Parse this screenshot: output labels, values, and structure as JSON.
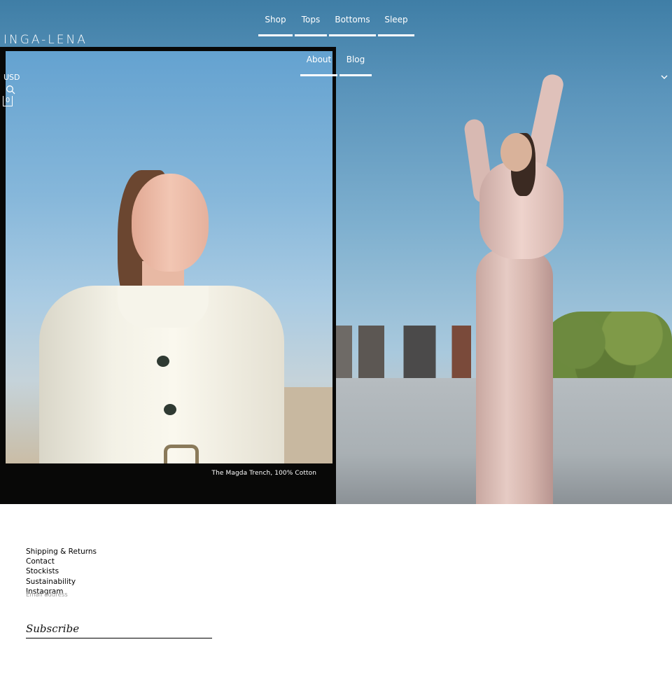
{
  "brand": {
    "logo_text": "INGA-LENA"
  },
  "nav": {
    "row1": [
      {
        "label": "Shop"
      },
      {
        "label": "Tops"
      },
      {
        "label": "Bottoms"
      },
      {
        "label": "Sleep"
      }
    ],
    "row2": [
      {
        "label": "About"
      },
      {
        "label": "Blog"
      }
    ]
  },
  "header": {
    "currency": "USD",
    "cart_count": "0",
    "icons": {
      "search": "search-icon",
      "chevron": "chevron-down-icon",
      "cart": "cart-icon"
    }
  },
  "hero": {
    "caption": "The Magda Trench, 100% Cotton"
  },
  "footer": {
    "links": [
      {
        "label": "Shipping & Returns"
      },
      {
        "label": "Contact"
      },
      {
        "label": "Stockists"
      },
      {
        "label": "Sustainability"
      },
      {
        "label": "Instagram"
      }
    ],
    "email_placeholder": "Email address",
    "subscribe_label": "Subscribe"
  },
  "colors": {
    "text_on_hero": "#ffffff",
    "footer_text": "#000000",
    "background": "#ffffff"
  }
}
